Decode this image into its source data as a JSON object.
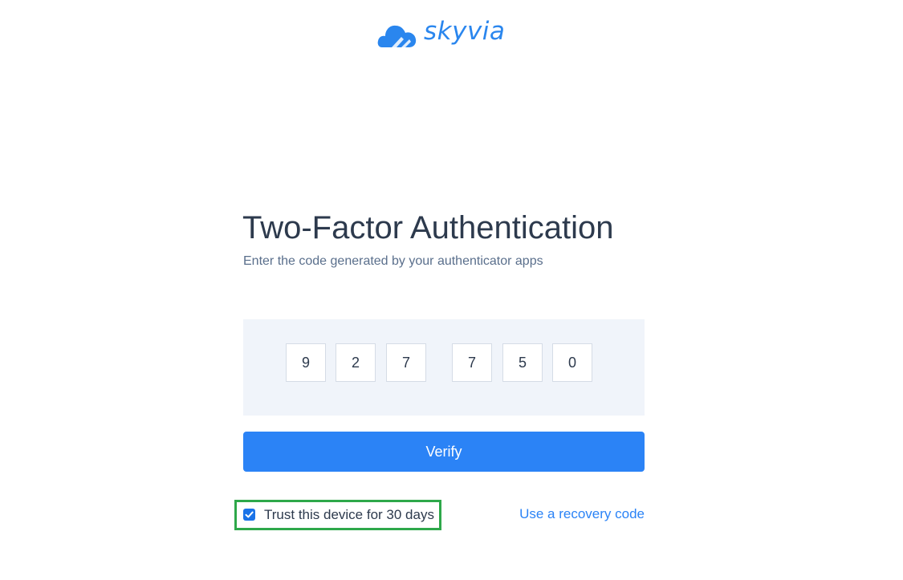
{
  "brand": {
    "name": "skyvia",
    "color": "#2a86ee",
    "icon": "cloud-logo-icon"
  },
  "page": {
    "title": "Two-Factor Authentication",
    "subtitle": "Enter the code generated by your authenticator apps"
  },
  "code": {
    "digits": [
      "9",
      "2",
      "7",
      "7",
      "5",
      "0"
    ]
  },
  "actions": {
    "verify_label": "Verify",
    "verify_color": "#2b83f6",
    "recovery_link": "Use a recovery code"
  },
  "trust": {
    "label": "Trust this device for 30 days",
    "checked": true,
    "highlight_color": "#2ea84a"
  }
}
